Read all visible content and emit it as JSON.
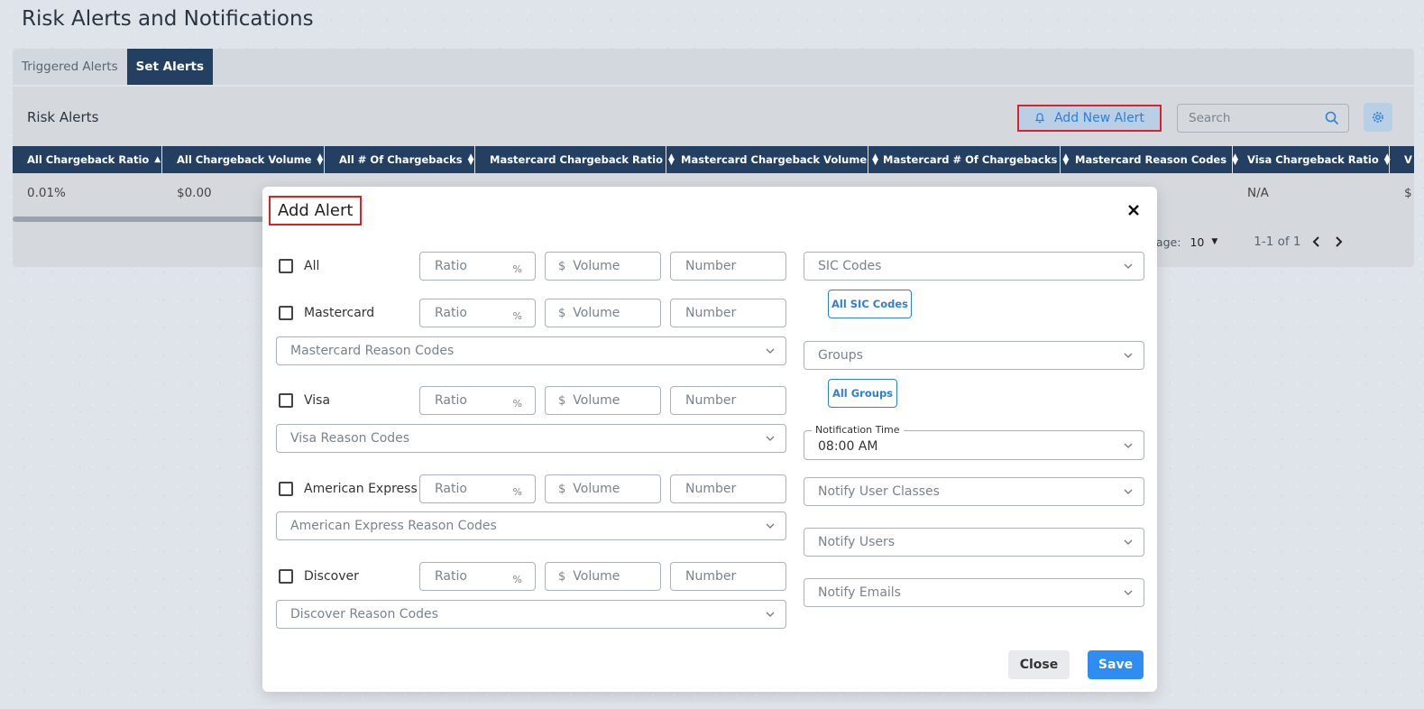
{
  "page": {
    "title": "Risk Alerts and Notifications"
  },
  "tabs": [
    {
      "label": "Triggered Alerts",
      "active": false
    },
    {
      "label": "Set Alerts",
      "active": true
    }
  ],
  "card": {
    "title": "Risk Alerts",
    "add_new_label": "Add New Alert",
    "search_placeholder": "Search"
  },
  "table": {
    "columns": [
      "All Chargeback Ratio",
      "All Chargeback Volume",
      "All # Of Chargebacks",
      "Mastercard Chargeback Ratio",
      "Mastercard Chargeback Volume",
      "Mastercard # Of Chargebacks",
      "Mastercard Reason Codes",
      "Visa Chargeback Ratio",
      "V"
    ],
    "row": [
      "0.01%",
      "$0.00",
      "",
      "",
      "",
      "",
      "",
      "N/A",
      "$"
    ]
  },
  "pagination": {
    "rows_label": "page:",
    "rows_value": "10",
    "range": "1-1 of 1"
  },
  "modal": {
    "title": "Add Alert",
    "ratio_placeholder": "Ratio",
    "percent_sign": "%",
    "dollar_sign": "$",
    "volume_placeholder": "Volume",
    "number_placeholder": "Number",
    "brands": [
      {
        "label": "All",
        "reason_codes": ""
      },
      {
        "label": "Mastercard",
        "reason_codes": "Mastercard Reason Codes"
      },
      {
        "label": "Visa",
        "reason_codes": "Visa Reason Codes"
      },
      {
        "label": "American Express",
        "reason_codes": "American Express Reason Codes"
      },
      {
        "label": "Discover",
        "reason_codes": "Discover Reason Codes"
      }
    ],
    "sic_codes": "SIC Codes",
    "all_sic_codes": "All SIC Codes",
    "groups": "Groups",
    "all_groups": "All Groups",
    "notification_time_label": "Notification Time",
    "notification_time_value": "08:00 AM",
    "notify_user_classes": "Notify User Classes",
    "notify_users": "Notify Users",
    "notify_emails": "Notify Emails",
    "close_label": "Close",
    "save_label": "Save"
  },
  "colors": {
    "header_navy": "#234063",
    "accent_blue": "#2f8cf0",
    "highlight_red": "#d8232a"
  }
}
